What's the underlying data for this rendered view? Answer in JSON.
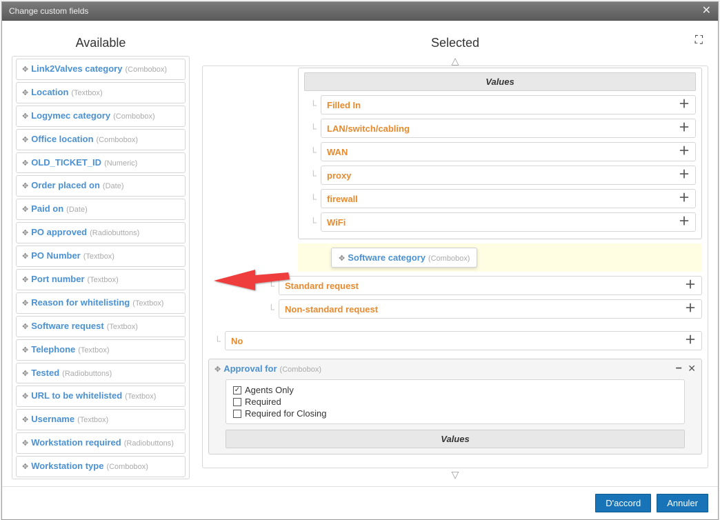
{
  "dialog": {
    "title": "Change custom fields"
  },
  "columns": {
    "available": "Available",
    "selected": "Selected"
  },
  "available": [
    {
      "label": "Link2Valves category",
      "type": "Combobox"
    },
    {
      "label": "Location",
      "type": "Textbox"
    },
    {
      "label": "Logymec category",
      "type": "Combobox"
    },
    {
      "label": "Office location",
      "type": "Combobox"
    },
    {
      "label": "OLD_TICKET_ID",
      "type": "Numeric"
    },
    {
      "label": "Order placed on",
      "type": "Date"
    },
    {
      "label": "Paid on",
      "type": "Date"
    },
    {
      "label": "PO approved",
      "type": "Radiobuttons"
    },
    {
      "label": "PO Number",
      "type": "Textbox"
    },
    {
      "label": "Port number",
      "type": "Textbox"
    },
    {
      "label": "Reason for whitelisting",
      "type": "Textbox"
    },
    {
      "label": "Software request",
      "type": "Textbox"
    },
    {
      "label": "Telephone",
      "type": "Textbox"
    },
    {
      "label": "Tested",
      "type": "Radiobuttons"
    },
    {
      "label": "URL to be whitelisted",
      "type": "Textbox"
    },
    {
      "label": "Username",
      "type": "Textbox"
    },
    {
      "label": "Workstation required",
      "type": "Radiobuttons"
    },
    {
      "label": "Workstation type",
      "type": "Combobox"
    }
  ],
  "selected": {
    "values_heading": "Values",
    "network_values": [
      "Filled In",
      "LAN/switch/cabling",
      "WAN",
      "proxy",
      "firewall",
      "WiFi"
    ],
    "drag_item": {
      "label": "Software category",
      "type": "Combobox"
    },
    "standard_values": [
      "Standard request",
      "Non-standard request"
    ],
    "no_value": "No",
    "approval_panel": {
      "label": "Approval for",
      "type": "Combobox",
      "checks": [
        {
          "label": "Agents Only",
          "checked": true
        },
        {
          "label": "Required",
          "checked": false
        },
        {
          "label": "Required for Closing",
          "checked": false
        }
      ],
      "values_heading": "Values"
    }
  },
  "footer": {
    "ok": "D'accord",
    "cancel": "Annuler"
  }
}
